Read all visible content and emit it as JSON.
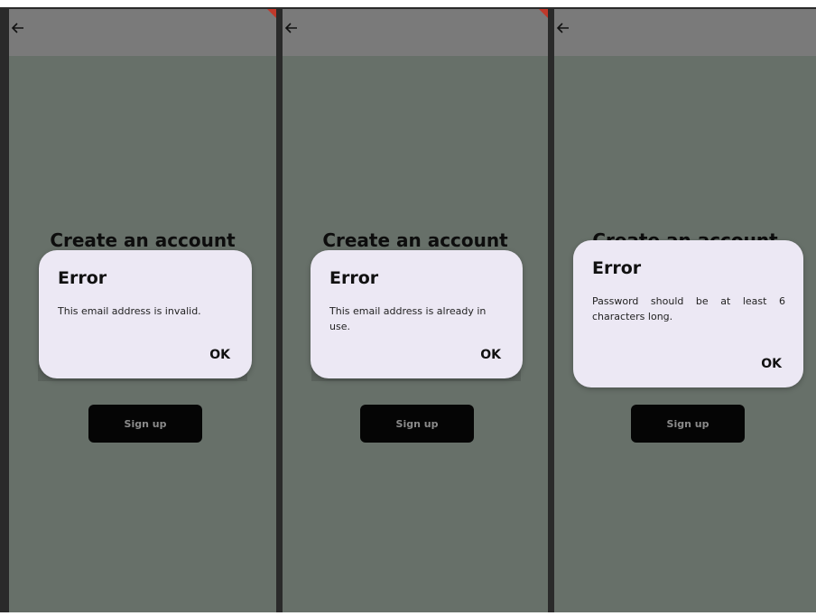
{
  "screens": [
    {
      "page_title": "Create an account",
      "dialog": {
        "title": "Error",
        "message": "This email address is invalid.",
        "ok_label": "OK"
      },
      "signup_label": "Sign up"
    },
    {
      "page_title": "Create an account",
      "dialog": {
        "title": "Error",
        "message": "This email address is already in use.",
        "ok_label": "OK"
      },
      "signup_label": "Sign up"
    },
    {
      "page_title": "Create an account",
      "dialog": {
        "title": "Error",
        "message": "Password should be at least 6 characters long.",
        "ok_label": "OK"
      },
      "signup_label": "Sign up"
    }
  ],
  "icons": {
    "back": "back-arrow-icon",
    "badge": "debug-banner-icon"
  },
  "colors": {
    "background": "#677069",
    "appbar": "#7a7a7a",
    "dialog": "#ece8f4",
    "button": "#050505"
  }
}
